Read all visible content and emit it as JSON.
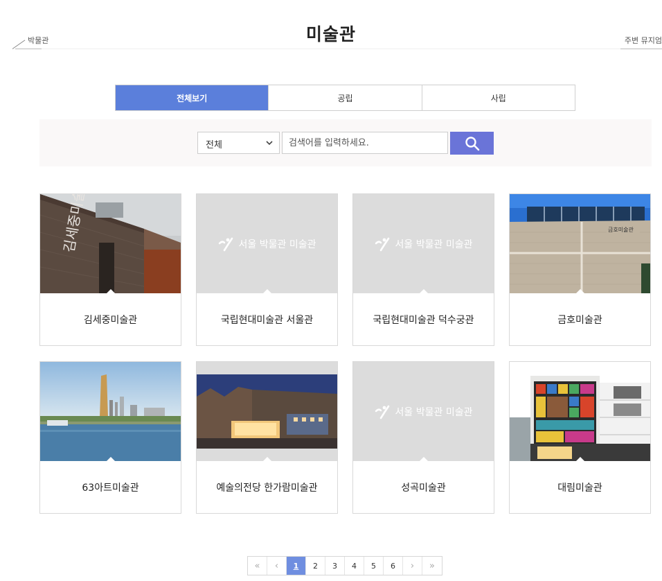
{
  "header": {
    "title": "미술관",
    "prev_label": "박물관",
    "next_label": "주변 뮤지엄"
  },
  "tabs": [
    {
      "label": "전체보기",
      "active": true
    },
    {
      "label": "공립",
      "active": false
    },
    {
      "label": "사립",
      "active": false
    }
  ],
  "search": {
    "category_selected": "전체",
    "placeholder": "검색어를 입력하세요.",
    "icon": "search-icon"
  },
  "placeholder_logo_text": "서울 박물관 미술관",
  "cards": [
    {
      "name": "김세중미술관",
      "image": "photo"
    },
    {
      "name": "국립현대미술관 서울관",
      "image": "placeholder"
    },
    {
      "name": "국립현대미술관 덕수궁관",
      "image": "placeholder"
    },
    {
      "name": "금호미술관",
      "image": "photo"
    },
    {
      "name": "63아트미술관",
      "image": "photo"
    },
    {
      "name": "예술의전당 한가람미술관",
      "image": "photo"
    },
    {
      "name": "성곡미술관",
      "image": "placeholder"
    },
    {
      "name": "대림미술관",
      "image": "photo"
    }
  ],
  "pagination": {
    "first": "«",
    "prev": "‹",
    "pages": [
      "1",
      "2",
      "3",
      "4",
      "5",
      "6"
    ],
    "current": "1",
    "next": "›",
    "last": "»"
  },
  "colors": {
    "accent_tab": "#5b7fdb",
    "search_button": "#6a74d8",
    "pager_active": "#6f8ee0"
  }
}
